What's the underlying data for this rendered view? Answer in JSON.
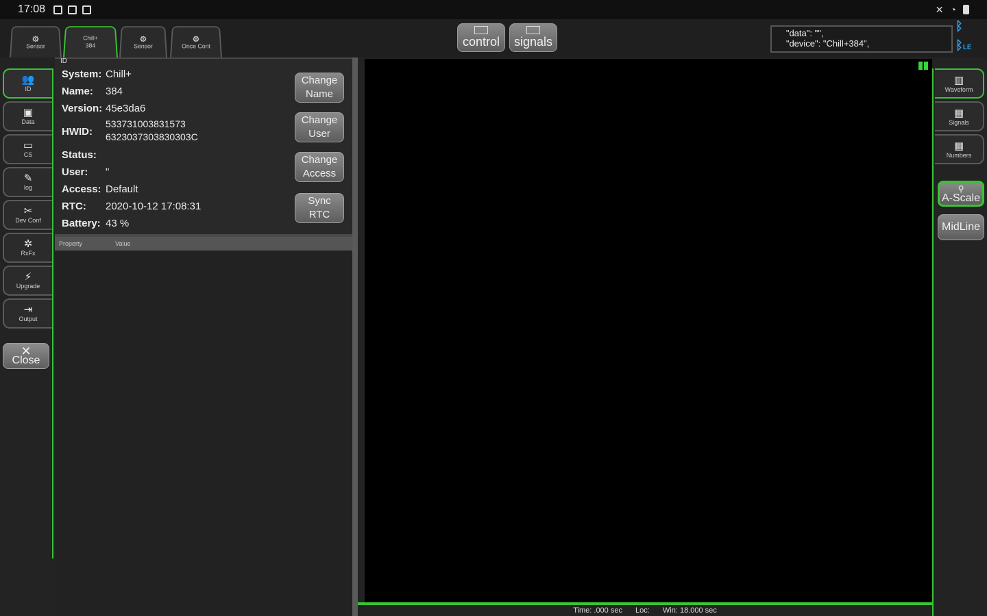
{
  "status_bar": {
    "time": "17:08"
  },
  "top_tabs": [
    {
      "icon": "⚙",
      "label": "Sensor"
    },
    {
      "icon": "",
      "label": "Chill+ 384"
    },
    {
      "icon": "⚙",
      "label": "Sensor"
    },
    {
      "icon": "⚙",
      "label": "Once Cont"
    }
  ],
  "center_buttons": {
    "control": "control",
    "signals": "signals"
  },
  "json_preview": "   \"data\": \"\",\n   \"device\": \"Chill+384\",",
  "bluetooth": {
    "le_label": "LE"
  },
  "left_tabs": [
    {
      "label": "ID",
      "icon": "person-icon"
    },
    {
      "label": "Data",
      "icon": "database-icon"
    },
    {
      "label": "CS",
      "icon": "window-icon"
    },
    {
      "label": "log",
      "icon": "notes-icon"
    },
    {
      "label": "Dev Conf",
      "icon": "tools-icon"
    },
    {
      "label": "RxFx",
      "icon": "gear-icon"
    },
    {
      "label": "Upgrade",
      "icon": "bolt-icon"
    },
    {
      "label": "Output",
      "icon": "output-icon"
    }
  ],
  "close_label": "Close",
  "info": {
    "section_label": "ID",
    "system_key": "System:",
    "system_val": "Chill+",
    "name_key": "Name:",
    "name_val": "384",
    "version_key": "Version:",
    "version_val": "45e3da6",
    "hwid_key": "HWID:",
    "hwid_line1": "533731003831573",
    "hwid_line2": "6323037303830303C",
    "status_key": "Status:",
    "status_val": "",
    "user_key": "User:",
    "user_val": "\"",
    "access_key": "Access:",
    "access_val": "Default",
    "rtc_key": "RTC:",
    "rtc_val": "2020-10-12 17:08:31",
    "battery_key": "Battery:",
    "battery_val": "43 %"
  },
  "actions": {
    "change_name": [
      "Change",
      "Name"
    ],
    "change_user": [
      "Change",
      "User"
    ],
    "change_access": [
      "Change",
      "Access"
    ],
    "sync_rtc": [
      "Sync",
      "RTC"
    ]
  },
  "table": {
    "col_property": "Property",
    "col_value": "Value"
  },
  "bottom_status": {
    "time": "Time: .000 sec",
    "loc": "Loc:",
    "win": "Win: 18.000 sec"
  },
  "right_tabs": [
    {
      "label": "Waveform"
    },
    {
      "label": "Signals"
    },
    {
      "label": "Numbers"
    }
  ],
  "right_buttons": {
    "ascale": "A-Scale",
    "midline": "MidLine"
  },
  "colors": {
    "accent": "#38c433",
    "bluetooth": "#2aa4f0"
  }
}
